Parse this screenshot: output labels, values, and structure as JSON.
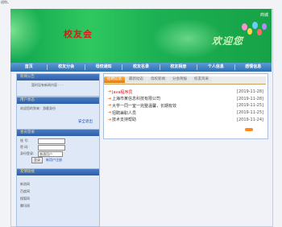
{
  "top_note": "适你。",
  "banner": {
    "site_title": "校友会",
    "welcome": "欢迎您",
    "shop": "商城"
  },
  "nav": [
    "首页",
    "校友分会",
    "母校通知",
    "校友名录",
    "校友相册",
    "个人信息",
    "感情信息"
  ],
  "sidebar": {
    "news_title": "新闻公告",
    "news_body": "暂时没有新闻内容 · · ·",
    "status_title": "用户状态",
    "status_text": "欢迎您的到来：游客身份",
    "logout": "安全退出",
    "login_title": "会员登录",
    "username_label": "账  号:",
    "password_label": "密  码:",
    "role_label": "身份登录:",
    "role_value": "普通用户",
    "login_button": "登录",
    "register_link": "新用户注册",
    "friends_title": "友情链接",
    "friends_items": [
      "新浪网",
      "百度网",
      "搜狐网",
      "腾讯网"
    ]
  },
  "tabs": [
    "招聘信息",
    "最新动态",
    "母校新闻",
    "分会简报",
    "校友风采"
  ],
  "news": [
    {
      "text": "Java程序员",
      "date": "[2019-11-28]"
    },
    {
      "text": "上海市某信息科技有限公司",
      "date": "[2019-11-28]"
    },
    {
      "text": "大学一同一室一完整温馨，长期有效",
      "date": "[2019-11-25]"
    },
    {
      "text": "招聘兼职人员",
      "date": "[2019-11-25]"
    },
    {
      "text": "技术支持帮助",
      "date": "[2019-11-24]"
    }
  ],
  "colors": {
    "banner_green": "#17a247",
    "title_red": "#e21515",
    "nav_blue": "#2f6fb1",
    "tab_orange": "#e07a10",
    "bullet_orange": "#ff6600"
  }
}
